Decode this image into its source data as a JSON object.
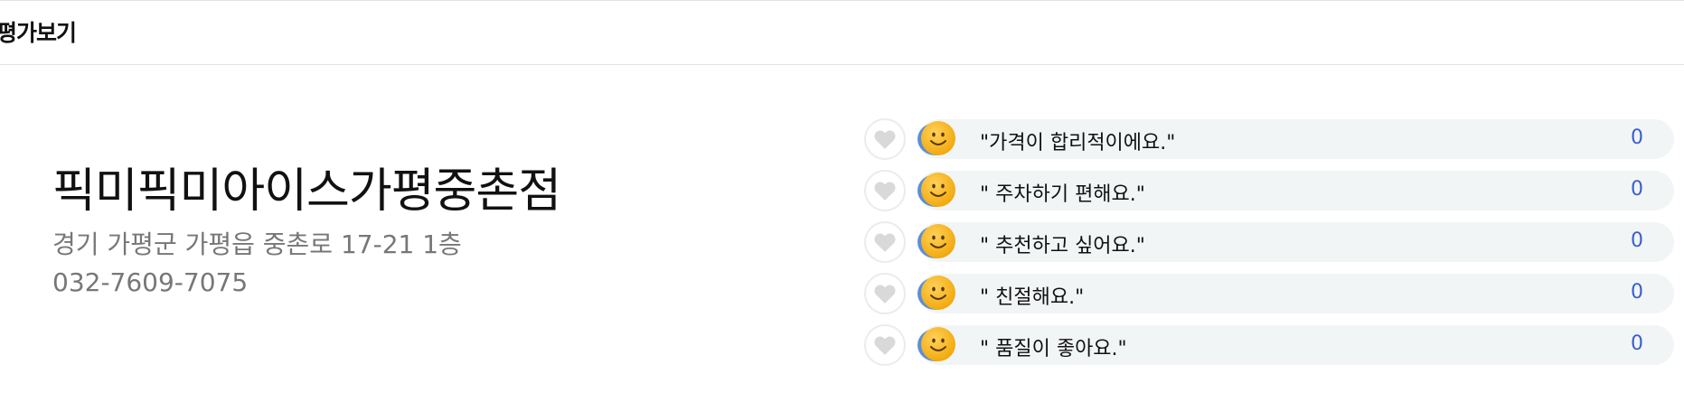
{
  "header": {
    "title": "평가보기"
  },
  "store": {
    "name": "픽미픽미아이스가평중촌점",
    "address": "경기 가평군 가평읍 중촌로 17-21 1층",
    "phone": "032-7609-7075"
  },
  "reviews": [
    {
      "text": "\"가격이 합리적이에요.\"",
      "count": "0"
    },
    {
      "text": "\" 주차하기 편해요.\"",
      "count": "0"
    },
    {
      "text": "\" 추천하고 싶어요.\"",
      "count": "0"
    },
    {
      "text": "\" 친절해요.\"",
      "count": "0"
    },
    {
      "text": "\" 품질이 좋아요.\"",
      "count": "0"
    }
  ],
  "icons": {
    "like": "heart-icon",
    "emoji": "smiley-icon"
  },
  "colors": {
    "count": "#3a5fcd",
    "pill": "#f2f5f6",
    "heart": "#d9d9d9",
    "emoji": "#f5b21c"
  }
}
